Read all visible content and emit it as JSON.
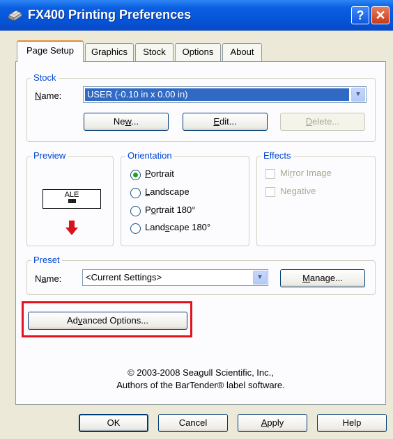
{
  "window": {
    "title": "FX400 Printing Preferences",
    "help_glyph": "?",
    "close_glyph": "✕"
  },
  "tabs": [
    "Page Setup",
    "Graphics",
    "Stock",
    "Options",
    "About"
  ],
  "stock": {
    "group_label": "Stock",
    "name_label": "Name:",
    "selected": "USER (-0.10 in x 0.00 in)",
    "buttons": {
      "new": "New...",
      "edit": "Edit...",
      "delete": "Delete..."
    }
  },
  "preview": {
    "group_label": "Preview",
    "label_text": "ALE",
    "barcode_text": "IIIIIIIII"
  },
  "orientation": {
    "group_label": "Orientation",
    "options": [
      "Portrait",
      "Landscape",
      "Portrait 180°",
      "Landscape 180°"
    ],
    "selected": "Portrait"
  },
  "effects": {
    "group_label": "Effects",
    "options": [
      "Mirror Image",
      "Negative"
    ]
  },
  "preset": {
    "group_label": "Preset",
    "name_label": "Name:",
    "selected": "<Current Settings>",
    "manage_label": "Manage..."
  },
  "advanced_label": "Advanced Options...",
  "copyright": {
    "line1": "© 2003-2008 Seagull Scientific, Inc.,",
    "line2": "Authors of the BarTender® label software."
  },
  "footer": {
    "ok": "OK",
    "cancel": "Cancel",
    "apply": "Apply",
    "help": "Help"
  },
  "colors": {
    "title_bar": "#0553d6",
    "group_label": "#0046d5",
    "highlight": "#e5101d",
    "radio_dot": "#21a121"
  }
}
